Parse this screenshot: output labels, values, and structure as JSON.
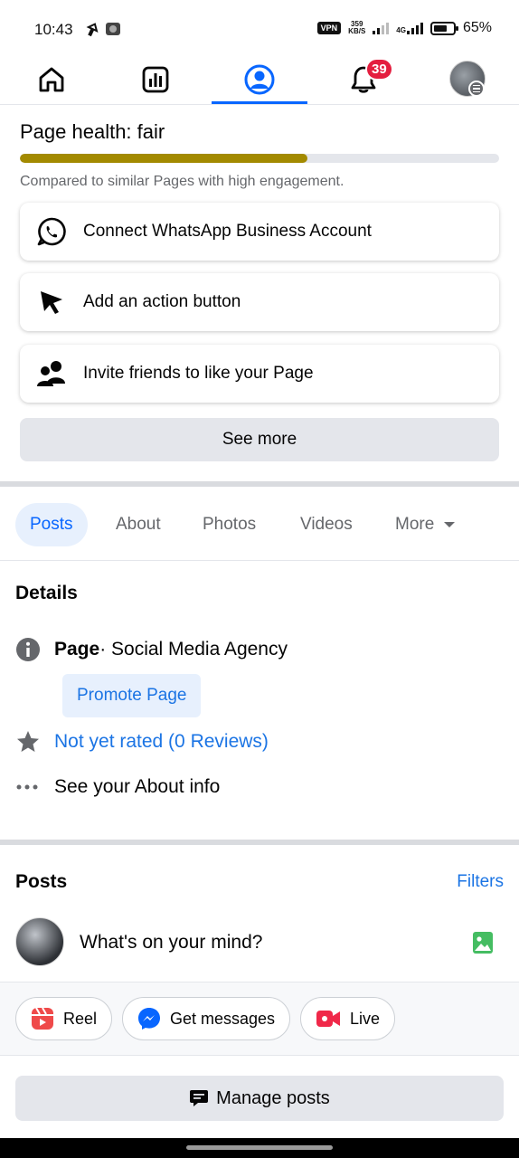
{
  "status_bar": {
    "time": "10:43",
    "vpn": "VPN",
    "speed_value": "359",
    "speed_unit": "KB/S",
    "network": "4G",
    "battery": "65%"
  },
  "nav": {
    "notifications_count": "39",
    "active_tab": "profile"
  },
  "health": {
    "title": "Page health:",
    "status": "fair",
    "level_fraction": 0.6,
    "bar_color": "#a38a00",
    "subtitle": "Compared to similar Pages with high engagement."
  },
  "cards": [
    {
      "label": "Connect WhatsApp Business Account",
      "icon": "whatsapp-icon"
    },
    {
      "label": "Add an action button",
      "icon": "cursor-icon"
    },
    {
      "label": "Invite friends to like your Page",
      "icon": "friends-icon"
    }
  ],
  "see_more_label": "See more",
  "tabs": {
    "posts": "Posts",
    "about": "About",
    "photos": "Photos",
    "videos": "Videos",
    "more": "More"
  },
  "details": {
    "heading": "Details",
    "page_label": "Page",
    "page_category": " · Social Media Agency",
    "promote_label": "Promote Page",
    "rating": "Not yet rated (0 Reviews)",
    "about_info": "See your About info"
  },
  "posts": {
    "heading": "Posts",
    "filters_label": "Filters",
    "composer_placeholder": "What's on your mind?",
    "chips": {
      "reel": "Reel",
      "messages": "Get messages",
      "live": "Live"
    },
    "manage_label": "Manage posts"
  },
  "colors": {
    "accent": "#0866ff",
    "link": "#1b74e4",
    "badge": "#e41e3f"
  }
}
